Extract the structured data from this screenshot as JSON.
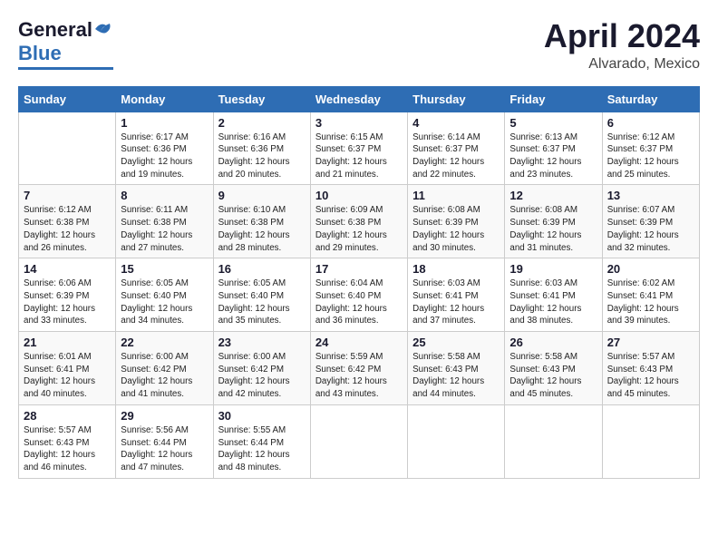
{
  "header": {
    "logo_general": "General",
    "logo_blue": "Blue",
    "month_year": "April 2024",
    "location": "Alvarado, Mexico"
  },
  "weekdays": [
    "Sunday",
    "Monday",
    "Tuesday",
    "Wednesday",
    "Thursday",
    "Friday",
    "Saturday"
  ],
  "weeks": [
    [
      {
        "day": "",
        "sunrise": "",
        "sunset": "",
        "daylight": ""
      },
      {
        "day": "1",
        "sunrise": "Sunrise: 6:17 AM",
        "sunset": "Sunset: 6:36 PM",
        "daylight": "Daylight: 12 hours and 19 minutes."
      },
      {
        "day": "2",
        "sunrise": "Sunrise: 6:16 AM",
        "sunset": "Sunset: 6:36 PM",
        "daylight": "Daylight: 12 hours and 20 minutes."
      },
      {
        "day": "3",
        "sunrise": "Sunrise: 6:15 AM",
        "sunset": "Sunset: 6:37 PM",
        "daylight": "Daylight: 12 hours and 21 minutes."
      },
      {
        "day": "4",
        "sunrise": "Sunrise: 6:14 AM",
        "sunset": "Sunset: 6:37 PM",
        "daylight": "Daylight: 12 hours and 22 minutes."
      },
      {
        "day": "5",
        "sunrise": "Sunrise: 6:13 AM",
        "sunset": "Sunset: 6:37 PM",
        "daylight": "Daylight: 12 hours and 23 minutes."
      },
      {
        "day": "6",
        "sunrise": "Sunrise: 6:12 AM",
        "sunset": "Sunset: 6:37 PM",
        "daylight": "Daylight: 12 hours and 25 minutes."
      }
    ],
    [
      {
        "day": "7",
        "sunrise": "Sunrise: 6:12 AM",
        "sunset": "Sunset: 6:38 PM",
        "daylight": "Daylight: 12 hours and 26 minutes."
      },
      {
        "day": "8",
        "sunrise": "Sunrise: 6:11 AM",
        "sunset": "Sunset: 6:38 PM",
        "daylight": "Daylight: 12 hours and 27 minutes."
      },
      {
        "day": "9",
        "sunrise": "Sunrise: 6:10 AM",
        "sunset": "Sunset: 6:38 PM",
        "daylight": "Daylight: 12 hours and 28 minutes."
      },
      {
        "day": "10",
        "sunrise": "Sunrise: 6:09 AM",
        "sunset": "Sunset: 6:38 PM",
        "daylight": "Daylight: 12 hours and 29 minutes."
      },
      {
        "day": "11",
        "sunrise": "Sunrise: 6:08 AM",
        "sunset": "Sunset: 6:39 PM",
        "daylight": "Daylight: 12 hours and 30 minutes."
      },
      {
        "day": "12",
        "sunrise": "Sunrise: 6:08 AM",
        "sunset": "Sunset: 6:39 PM",
        "daylight": "Daylight: 12 hours and 31 minutes."
      },
      {
        "day": "13",
        "sunrise": "Sunrise: 6:07 AM",
        "sunset": "Sunset: 6:39 PM",
        "daylight": "Daylight: 12 hours and 32 minutes."
      }
    ],
    [
      {
        "day": "14",
        "sunrise": "Sunrise: 6:06 AM",
        "sunset": "Sunset: 6:39 PM",
        "daylight": "Daylight: 12 hours and 33 minutes."
      },
      {
        "day": "15",
        "sunrise": "Sunrise: 6:05 AM",
        "sunset": "Sunset: 6:40 PM",
        "daylight": "Daylight: 12 hours and 34 minutes."
      },
      {
        "day": "16",
        "sunrise": "Sunrise: 6:05 AM",
        "sunset": "Sunset: 6:40 PM",
        "daylight": "Daylight: 12 hours and 35 minutes."
      },
      {
        "day": "17",
        "sunrise": "Sunrise: 6:04 AM",
        "sunset": "Sunset: 6:40 PM",
        "daylight": "Daylight: 12 hours and 36 minutes."
      },
      {
        "day": "18",
        "sunrise": "Sunrise: 6:03 AM",
        "sunset": "Sunset: 6:41 PM",
        "daylight": "Daylight: 12 hours and 37 minutes."
      },
      {
        "day": "19",
        "sunrise": "Sunrise: 6:03 AM",
        "sunset": "Sunset: 6:41 PM",
        "daylight": "Daylight: 12 hours and 38 minutes."
      },
      {
        "day": "20",
        "sunrise": "Sunrise: 6:02 AM",
        "sunset": "Sunset: 6:41 PM",
        "daylight": "Daylight: 12 hours and 39 minutes."
      }
    ],
    [
      {
        "day": "21",
        "sunrise": "Sunrise: 6:01 AM",
        "sunset": "Sunset: 6:41 PM",
        "daylight": "Daylight: 12 hours and 40 minutes."
      },
      {
        "day": "22",
        "sunrise": "Sunrise: 6:00 AM",
        "sunset": "Sunset: 6:42 PM",
        "daylight": "Daylight: 12 hours and 41 minutes."
      },
      {
        "day": "23",
        "sunrise": "Sunrise: 6:00 AM",
        "sunset": "Sunset: 6:42 PM",
        "daylight": "Daylight: 12 hours and 42 minutes."
      },
      {
        "day": "24",
        "sunrise": "Sunrise: 5:59 AM",
        "sunset": "Sunset: 6:42 PM",
        "daylight": "Daylight: 12 hours and 43 minutes."
      },
      {
        "day": "25",
        "sunrise": "Sunrise: 5:58 AM",
        "sunset": "Sunset: 6:43 PM",
        "daylight": "Daylight: 12 hours and 44 minutes."
      },
      {
        "day": "26",
        "sunrise": "Sunrise: 5:58 AM",
        "sunset": "Sunset: 6:43 PM",
        "daylight": "Daylight: 12 hours and 45 minutes."
      },
      {
        "day": "27",
        "sunrise": "Sunrise: 5:57 AM",
        "sunset": "Sunset: 6:43 PM",
        "daylight": "Daylight: 12 hours and 45 minutes."
      }
    ],
    [
      {
        "day": "28",
        "sunrise": "Sunrise: 5:57 AM",
        "sunset": "Sunset: 6:43 PM",
        "daylight": "Daylight: 12 hours and 46 minutes."
      },
      {
        "day": "29",
        "sunrise": "Sunrise: 5:56 AM",
        "sunset": "Sunset: 6:44 PM",
        "daylight": "Daylight: 12 hours and 47 minutes."
      },
      {
        "day": "30",
        "sunrise": "Sunrise: 5:55 AM",
        "sunset": "Sunset: 6:44 PM",
        "daylight": "Daylight: 12 hours and 48 minutes."
      },
      {
        "day": "",
        "sunrise": "",
        "sunset": "",
        "daylight": ""
      },
      {
        "day": "",
        "sunrise": "",
        "sunset": "",
        "daylight": ""
      },
      {
        "day": "",
        "sunrise": "",
        "sunset": "",
        "daylight": ""
      },
      {
        "day": "",
        "sunrise": "",
        "sunset": "",
        "daylight": ""
      }
    ]
  ]
}
